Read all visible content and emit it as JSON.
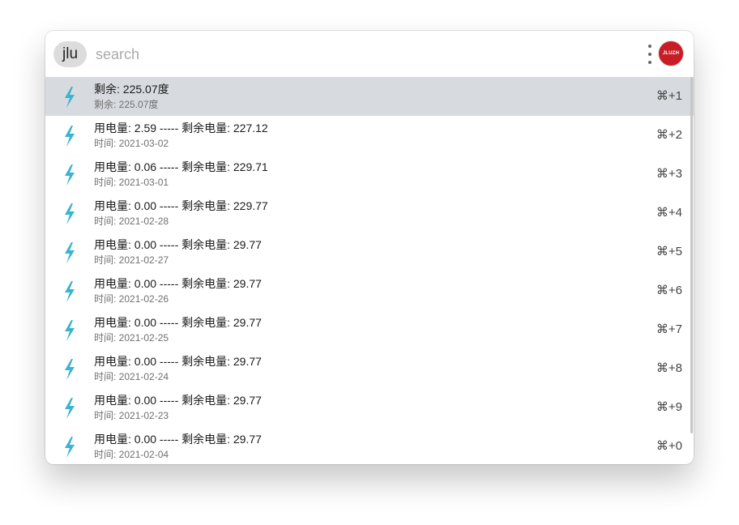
{
  "search": {
    "prefix": "jlu",
    "placeholder": "search",
    "value": ""
  },
  "plugin": {
    "logo_text": "JLUZH",
    "logo_color": "#c81d25"
  },
  "accent_icon_color": "#3ab4cf",
  "result_icon": "lightning-bolt-icon",
  "results": [
    {
      "title": "剩余: 225.07度",
      "subtitle": "剩余: 225.07度",
      "shortcut": "⌘+1",
      "selected": true
    },
    {
      "title": "用电量: 2.59 ----- 剩余电量: 227.12",
      "subtitle": "时间: 2021-03-02",
      "shortcut": "⌘+2"
    },
    {
      "title": "用电量: 0.06 ----- 剩余电量: 229.71",
      "subtitle": "时间: 2021-03-01",
      "shortcut": "⌘+3"
    },
    {
      "title": "用电量: 0.00 ----- 剩余电量: 229.77",
      "subtitle": "时间: 2021-02-28",
      "shortcut": "⌘+4"
    },
    {
      "title": "用电量: 0.00 ----- 剩余电量: 29.77",
      "subtitle": "时间: 2021-02-27",
      "shortcut": "⌘+5"
    },
    {
      "title": "用电量: 0.00 ----- 剩余电量: 29.77",
      "subtitle": "时间: 2021-02-26",
      "shortcut": "⌘+6"
    },
    {
      "title": "用电量: 0.00 ----- 剩余电量: 29.77",
      "subtitle": "时间: 2021-02-25",
      "shortcut": "⌘+7"
    },
    {
      "title": "用电量: 0.00 ----- 剩余电量: 29.77",
      "subtitle": "时间: 2021-02-24",
      "shortcut": "⌘+8"
    },
    {
      "title": "用电量: 0.00 ----- 剩余电量: 29.77",
      "subtitle": "时间: 2021-02-23",
      "shortcut": "⌘+9"
    },
    {
      "title": "用电量: 0.00 ----- 剩余电量: 29.77",
      "subtitle": "时间: 2021-02-04",
      "shortcut": "⌘+0"
    }
  ]
}
